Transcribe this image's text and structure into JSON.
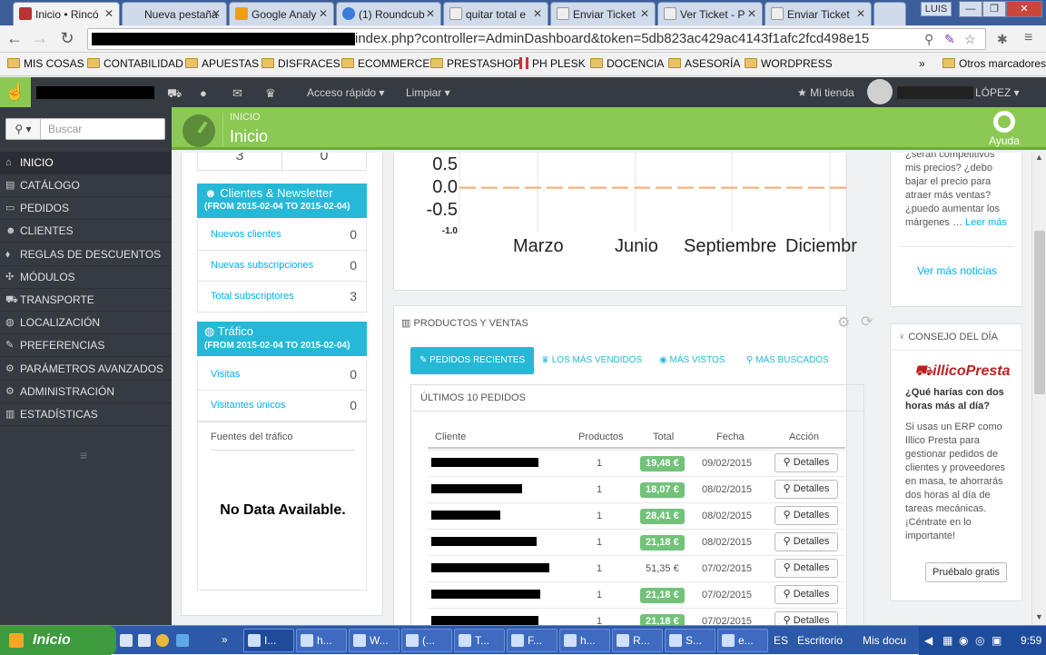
{
  "browser": {
    "tabs": [
      {
        "title": "Inicio • Rincó",
        "active": true
      },
      {
        "title": "Nueva pestaña",
        "active": false
      },
      {
        "title": "Google Analy",
        "active": false
      },
      {
        "title": "(1) Roundcub",
        "active": false
      },
      {
        "title": "quitar total e",
        "active": false
      },
      {
        "title": "Enviar Ticket",
        "active": false
      },
      {
        "title": "Ver Ticket - P",
        "active": false
      },
      {
        "title": "Enviar Ticket",
        "active": false
      }
    ],
    "tab_close": "✕",
    "user": "LUIS",
    "window_controls": [
      "—",
      "❐",
      "✕"
    ],
    "url": "index.php?controller=AdminDashboard&token=5db823ac429ac4143f1afc2fcd498e15",
    "bookmarks": [
      "MIS COSAS",
      "CONTABILIDAD",
      "APUESTAS",
      "DISFRACES",
      "ECOMMERCE",
      "PRESTASHOP",
      "PH PLESK",
      "DOCENCIA",
      "ASESORÍA",
      "WORDPRESS"
    ],
    "bookmarks_more": "»",
    "other_bookmarks": "Otros marcadores"
  },
  "topbar": {
    "quick_access": "Acceso rápido ▾",
    "clear": "Limpiar ▾",
    "my_store": "Mi tienda",
    "user_name": "LÓPEZ ▾"
  },
  "sidebar": {
    "search_placeholder": "Buscar",
    "items": [
      "INICIO",
      "CATÁLOGO",
      "PEDIDOS",
      "CLIENTES",
      "REGLAS DE DESCUENTOS",
      "MÓDULOS",
      "TRANSPORTE",
      "LOCALIZACIÓN",
      "PREFERENCIAS",
      "PARÁMETROS AVANZADOS",
      "ADMINISTRACIÓN",
      "ESTADÍSTICAS"
    ],
    "icons": [
      "home-icon",
      "book-icon",
      "credit-card-icon",
      "users-icon",
      "tags-icon",
      "puzzle-icon",
      "truck-icon",
      "globe-icon",
      "wrench-icon",
      "cogs-icon",
      "cog-icon",
      "bar-chart-icon"
    ]
  },
  "header": {
    "breadcrumb": "INICIO",
    "title": "Inicio",
    "help": "Ayuda"
  },
  "stats": {
    "top_values": [
      "3",
      "0"
    ],
    "customers": {
      "title": "Clientes & Newsletter",
      "range": "(FROM 2015-02-04 TO 2015-02-04)",
      "rows": [
        {
          "label": "Nuevos clientes",
          "value": "0"
        },
        {
          "label": "Nuevas subscripciones",
          "value": "0"
        },
        {
          "label": "Total subscriptores",
          "value": "3"
        }
      ]
    },
    "traffic": {
      "title": "Tráfico",
      "range": "(FROM 2015-02-04 TO 2015-02-04)",
      "rows": [
        {
          "label": "Visitas",
          "value": "0"
        },
        {
          "label": "Visitantes únicos",
          "value": "0"
        }
      ],
      "sources_label": "Fuentes del tráfico",
      "no_data": "No Data Available."
    }
  },
  "chart_data": {
    "type": "line",
    "y_ticks": [
      "0.5",
      "0.0",
      "-0.5",
      "-1.0"
    ],
    "x_ticks": [
      "Marzo",
      "Junio",
      "Septiembre",
      "Diciembr"
    ],
    "series": [
      {
        "values": [
          0,
          0,
          0,
          0
        ]
      }
    ],
    "ylim": [
      -1.0,
      0.5
    ],
    "line_color": "#f5a96c"
  },
  "products": {
    "title": "PRODUCTOS Y VENTAS",
    "tabs": [
      "PEDIDOS RECIENTES",
      "LOS MÁS VENDIDOS",
      "MÁS VISTOS",
      "MÁS BUSCADOS"
    ],
    "orders_title": "ÚLTIMOS 10 PEDIDOS",
    "columns": [
      "Cliente",
      "Productos",
      "Total",
      "Fecha",
      "Acción"
    ],
    "rows": [
      {
        "products": "1",
        "total": "19,48 €",
        "paid": true,
        "date": "09/02/2015"
      },
      {
        "products": "1",
        "total": "18,07 €",
        "paid": true,
        "date": "08/02/2015"
      },
      {
        "products": "1",
        "total": "28,41 €",
        "paid": true,
        "date": "08/02/2015"
      },
      {
        "products": "1",
        "total": "21,18 €",
        "paid": true,
        "date": "08/02/2015"
      },
      {
        "products": "1",
        "total": "51,35 €",
        "paid": false,
        "date": "07/02/2015"
      },
      {
        "products": "1",
        "total": "21,18 €",
        "paid": true,
        "date": "07/02/2015"
      },
      {
        "products": "1",
        "total": "21,18 €",
        "paid": true,
        "date": "07/02/2015"
      }
    ],
    "details_label": "Detalles"
  },
  "news": {
    "text": "¿serán competitivos mis precios? ¿debo bajar el precio para atraer más ventas? ¿puedo aumentar los márgenes …",
    "read_more": "Leer más",
    "more_news": "Ver más noticias"
  },
  "tip": {
    "title": "CONSEJO DEL DÍA",
    "logo": "illicoPresta",
    "heading": "¿Qué harías con dos horas más al día?",
    "body": "Si usas un ERP como Illico Presta para gestionar pedidos de clientes y proveedores en masa, te ahorrarás dos horas al día de tareas mecánicas. ¡Céntrate en lo importante!",
    "button": "Pruébalo gratis"
  },
  "taskbar": {
    "start": "Inicio",
    "tasks": [
      "I...",
      "h...",
      "W...",
      "(...",
      "T...",
      "F...",
      "h...",
      "R...",
      "S...",
      "e..."
    ],
    "lang": "ES",
    "desktop": "Escritorio",
    "docs": "Mis docu",
    "time": "9:59"
  }
}
